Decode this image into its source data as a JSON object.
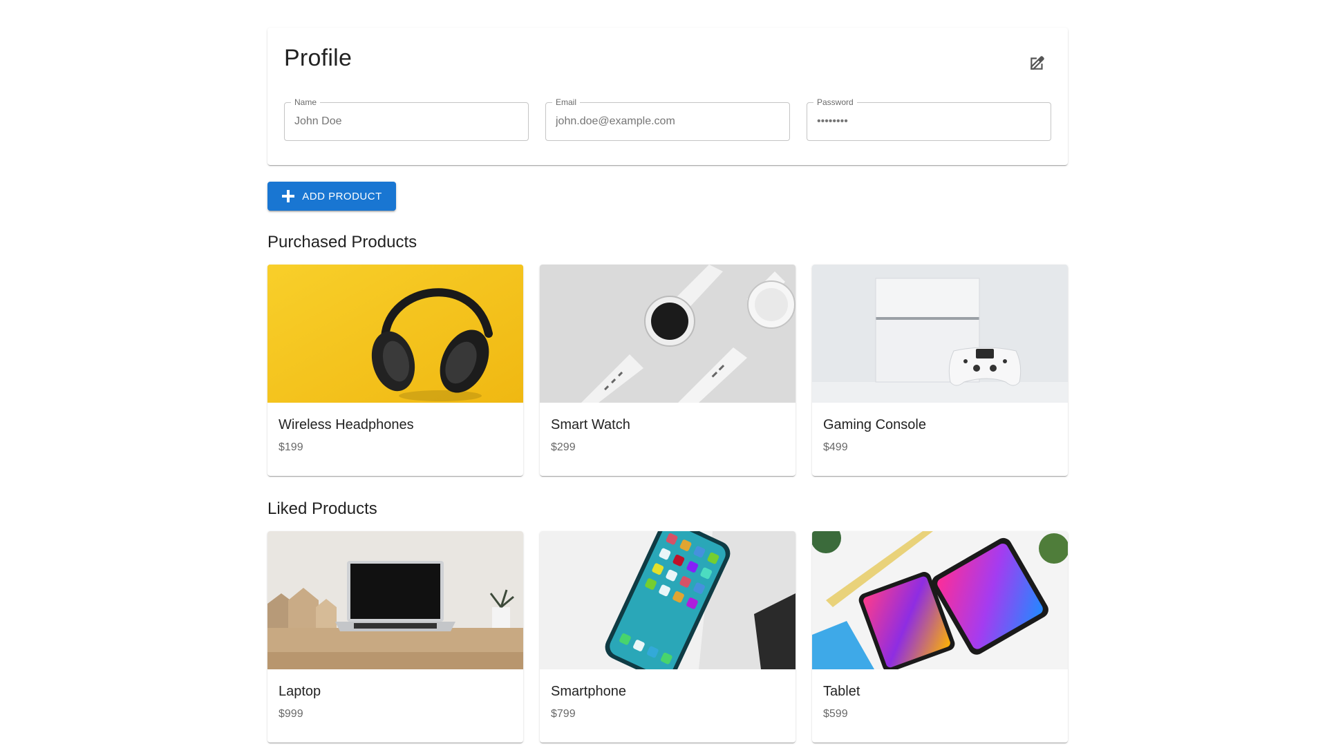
{
  "profile": {
    "title": "Profile",
    "fields": [
      {
        "label": "Name",
        "placeholder": "John Doe",
        "type": "text"
      },
      {
        "label": "Email",
        "placeholder": "john.doe@example.com",
        "type": "email"
      },
      {
        "label": "Password",
        "placeholder": "••••••••",
        "type": "password"
      }
    ],
    "edit_icon": "edit-icon"
  },
  "actions": {
    "add_product_label": "Add Product",
    "add_icon": "plus-icon"
  },
  "purchased": {
    "title": "Purchased Products",
    "items": [
      {
        "name": "Wireless Headphones",
        "price": "$199",
        "image": "headphones-image"
      },
      {
        "name": "Smart Watch",
        "price": "$299",
        "image": "smartwatch-image"
      },
      {
        "name": "Gaming Console",
        "price": "$499",
        "image": "console-image"
      }
    ]
  },
  "liked": {
    "title": "Liked Products",
    "items": [
      {
        "name": "Laptop",
        "price": "$999",
        "image": "laptop-image"
      },
      {
        "name": "Smartphone",
        "price": "$799",
        "image": "smartphone-image"
      },
      {
        "name": "Tablet",
        "price": "$599",
        "image": "tablet-image"
      }
    ]
  },
  "colors": {
    "primary": "#1976d2",
    "headphones_bg": "#f5c518",
    "watch_bg": "#dcdcdc",
    "console_bg": "#e4e7ea"
  }
}
